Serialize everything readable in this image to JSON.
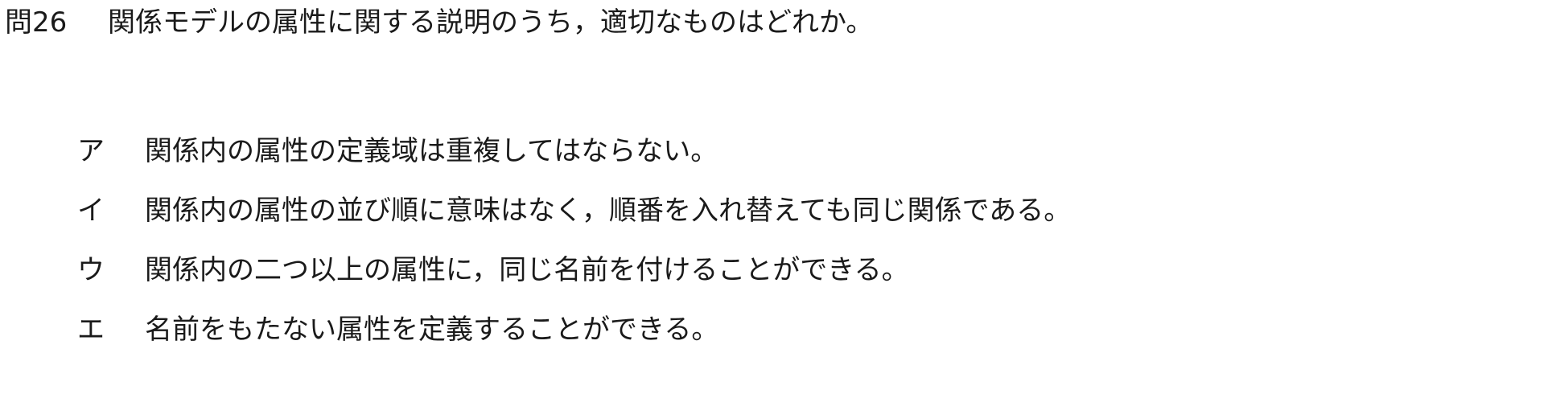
{
  "question": {
    "number": "問26",
    "text": "関係モデルの属性に関する説明のうち，適切なものはどれか。"
  },
  "choices": [
    {
      "label": "ア",
      "text": "関係内の属性の定義域は重複してはならない。"
    },
    {
      "label": "イ",
      "text": "関係内の属性の並び順に意味はなく，順番を入れ替えても同じ関係である。"
    },
    {
      "label": "ウ",
      "text": "関係内の二つ以上の属性に，同じ名前を付けることができる。"
    },
    {
      "label": "エ",
      "text": "名前をもたない属性を定義することができる。"
    }
  ]
}
